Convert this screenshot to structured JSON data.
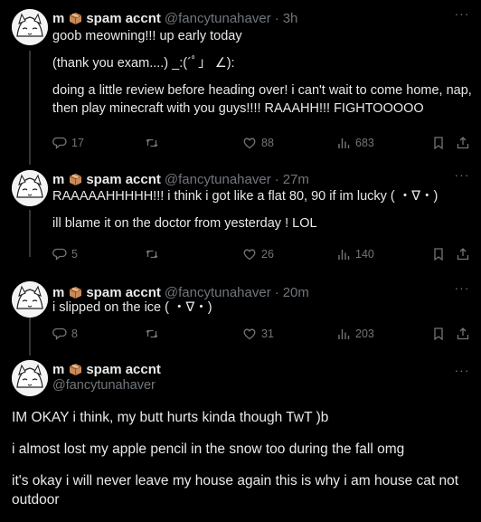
{
  "author": {
    "name": "m",
    "handle": "@fancytunahaver"
  },
  "posts": [
    {
      "time": "3h",
      "lines": [
        "goob meowning!!! up early today",
        "",
        "(thank you exam....) _:(´ﾟ」 ∠):",
        "",
        "doing a little review before heading over! i can't wait to come home, nap,",
        "then play minecraft with you guys!!!! RAAAHH!!! FIGHTOOOOO"
      ],
      "replies": "17",
      "reposts": "",
      "likes": "88",
      "views": "683"
    },
    {
      "time": "27m",
      "lines": [
        "RAAAAAHHHHH!!! i think i got like a flat 80, 90 if im lucky ( ・∇・)",
        "",
        "ill blame it on the doctor from yesterday ! LOL"
      ],
      "replies": "5",
      "reposts": "",
      "likes": "26",
      "views": "140"
    },
    {
      "time": "20m",
      "lines": [
        "i slipped on the ice ( ・∇・)"
      ],
      "replies": "8",
      "reposts": "",
      "likes": "31",
      "views": "203"
    }
  ],
  "main_post": {
    "lines": [
      "IM OKAY i think, my butt hurts kinda though TwT )b",
      "",
      "i almost lost my apple pencil in the snow too during the fall omg",
      "",
      "it's okay i will never leave my house again this is why i am house cat not",
      "outdoor"
    ]
  },
  "ui": {
    "display_name_suffix": "spam accnt",
    "separator": "·",
    "more_glyph": "···"
  },
  "icons": {
    "reply": "reply-icon",
    "repost": "repost-icon",
    "like": "heart-icon",
    "views": "views-icon",
    "bookmark": "bookmark-icon",
    "share": "share-icon",
    "name_emoji": "package-emoji-icon"
  },
  "colors": {
    "background": "#000000",
    "text": "#e7e9ea",
    "muted": "#71767b",
    "thread_line": "#333639"
  }
}
